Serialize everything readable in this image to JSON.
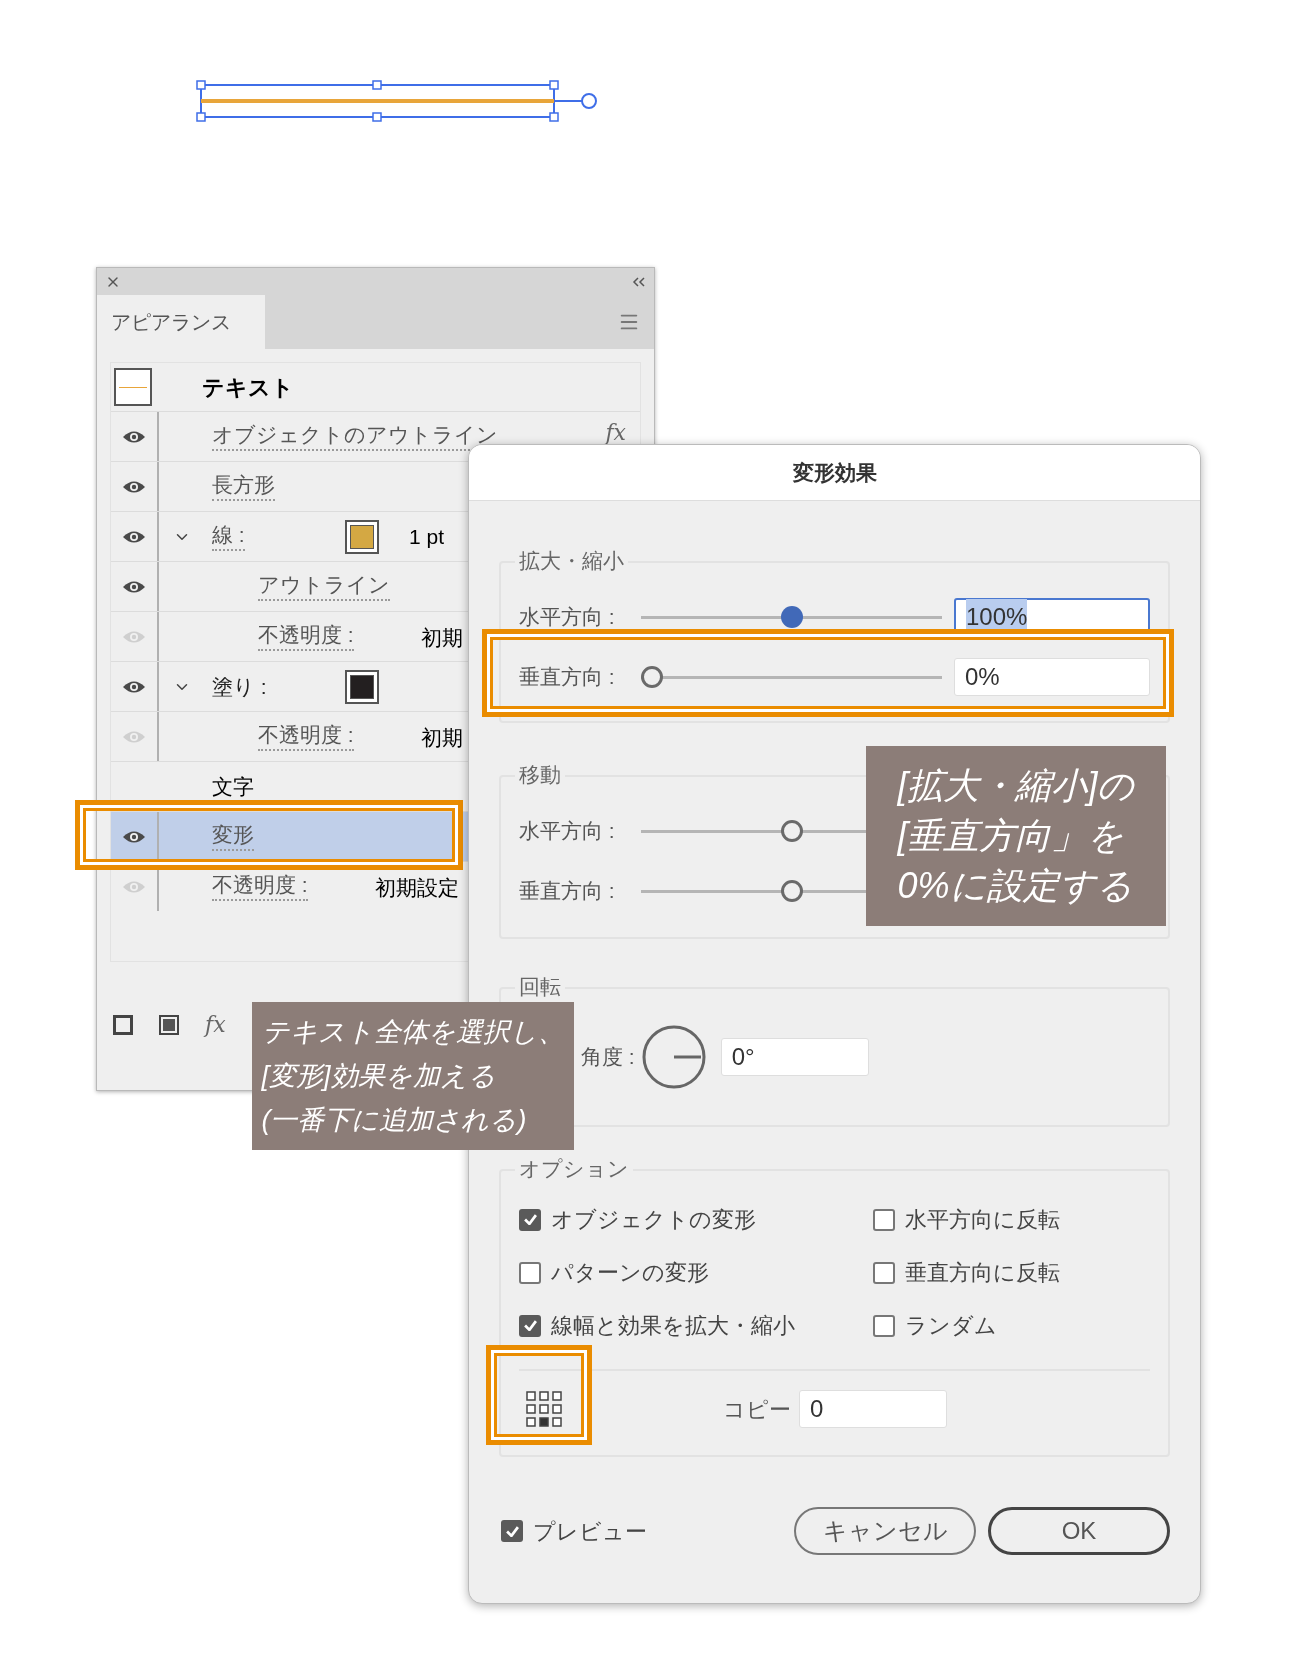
{
  "appearance_panel": {
    "tab": "アピアランス",
    "header": {
      "title": "テキスト"
    },
    "rows": [
      {
        "kind": "effect",
        "label": "オブジェクトのアウトライン",
        "visible": true,
        "selected": false,
        "fx": "fx"
      },
      {
        "kind": "effect",
        "label": "長方形",
        "visible": true,
        "selected": false
      },
      {
        "kind": "stroke",
        "label": "線 :",
        "visible": true,
        "selected": false,
        "expanded": true,
        "color": "#d4a843",
        "value": "1 pt"
      },
      {
        "kind": "sub",
        "label": "アウトライン",
        "visible": true,
        "selected": false
      },
      {
        "kind": "sub",
        "label": "不透明度 :",
        "visible": false,
        "selected": false,
        "value": "初期"
      },
      {
        "kind": "fill",
        "label": "塗り :",
        "visible": true,
        "selected": false,
        "expanded": true,
        "color": "#231f20"
      },
      {
        "kind": "sub",
        "label": "不透明度 :",
        "visible": false,
        "selected": false,
        "value": "初期"
      },
      {
        "kind": "group",
        "label": "文字",
        "selected": false
      },
      {
        "kind": "effect",
        "label": "変形",
        "visible": true,
        "selected": true
      },
      {
        "kind": "effect",
        "label": "不透明度 :",
        "visible": false,
        "selected": false,
        "value": "初期設定"
      }
    ],
    "footer_fx": "fx"
  },
  "dialog": {
    "title": "変形効果",
    "scale": {
      "title": "拡大・縮小",
      "rows": [
        {
          "label": "水平方向 :",
          "level": 0.5,
          "value": "100%",
          "focused": true
        },
        {
          "label": "垂直方向 :",
          "level": 0,
          "value": "0%",
          "focused": false
        }
      ]
    },
    "move": {
      "title": "移動",
      "rows": [
        {
          "label": "水平方向 :",
          "level": 0.5,
          "focused": false
        },
        {
          "label": "垂直方向 :",
          "level": 0.5,
          "focused": false
        }
      ]
    },
    "rotate": {
      "title": "回転",
      "label": "角度 :",
      "value": "0°"
    },
    "options": {
      "title": "オプション",
      "checkboxes": [
        {
          "label": "オブジェクトの変形",
          "checked": true
        },
        {
          "label": "水平方向に反転",
          "checked": false
        },
        {
          "label": "パターンの変形",
          "checked": false
        },
        {
          "label": "垂直方向に反転",
          "checked": false
        },
        {
          "label": "線幅と効果を拡大・縮小",
          "checked": true
        },
        {
          "label": "ランダム",
          "checked": false
        }
      ],
      "copies_label": "コピー",
      "copies": "0"
    },
    "preview": {
      "label": "プレビュー",
      "checked": true
    },
    "buttons": [
      {
        "label": "キャンセル",
        "default": false
      },
      {
        "label": "OK",
        "default": true
      }
    ]
  },
  "callouts": [
    {
      "text": "[拡大・縮小]の\n[垂直方向」を\n0%に設定する"
    },
    {
      "text": "テキスト全体を選択し、\n[変形]効果を加える\n(一番下に追加される)"
    }
  ]
}
